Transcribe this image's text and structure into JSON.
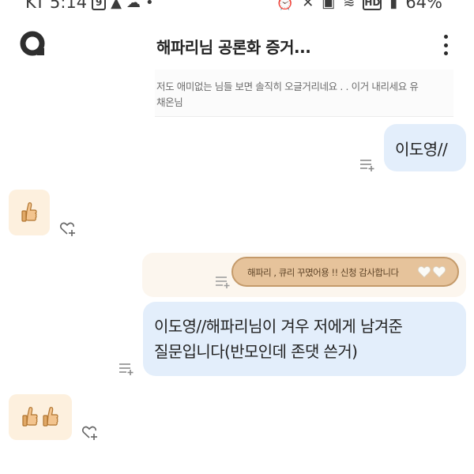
{
  "status_bar": {
    "carrier": "KT",
    "time": "5:14",
    "battery": "64%",
    "notification_badge": "9",
    "network_badge": "HD"
  },
  "header": {
    "title": "해파리님 공론화 증거..."
  },
  "quoted_post": {
    "line1": "저도 애미없는 님들 보면 솔직히 오글거리네요 . . 이거 내리세요 유",
    "line2": "채온님"
  },
  "messages": [
    {
      "side": "right",
      "text": "이도영//"
    },
    {
      "side": "left",
      "reaction": "thumbs-up",
      "count": 1
    },
    {
      "side": "right",
      "reply_preview": "해파리 , 큐리 꾸몄어용 !! 신청 감사합니다"
    },
    {
      "side": "right",
      "text_line1": "이도영//해파리님이 겨우 저에게 남겨준",
      "text_line2": "질문입니다(반모인데 존댓 쓴거)"
    },
    {
      "side": "left",
      "reaction": "thumbs-up",
      "count": 2
    }
  ],
  "colors": {
    "outgoing_bubble": "#e3eefb",
    "reaction_bubble": "#fdf0de",
    "reply_pill": "#e6c39b"
  }
}
